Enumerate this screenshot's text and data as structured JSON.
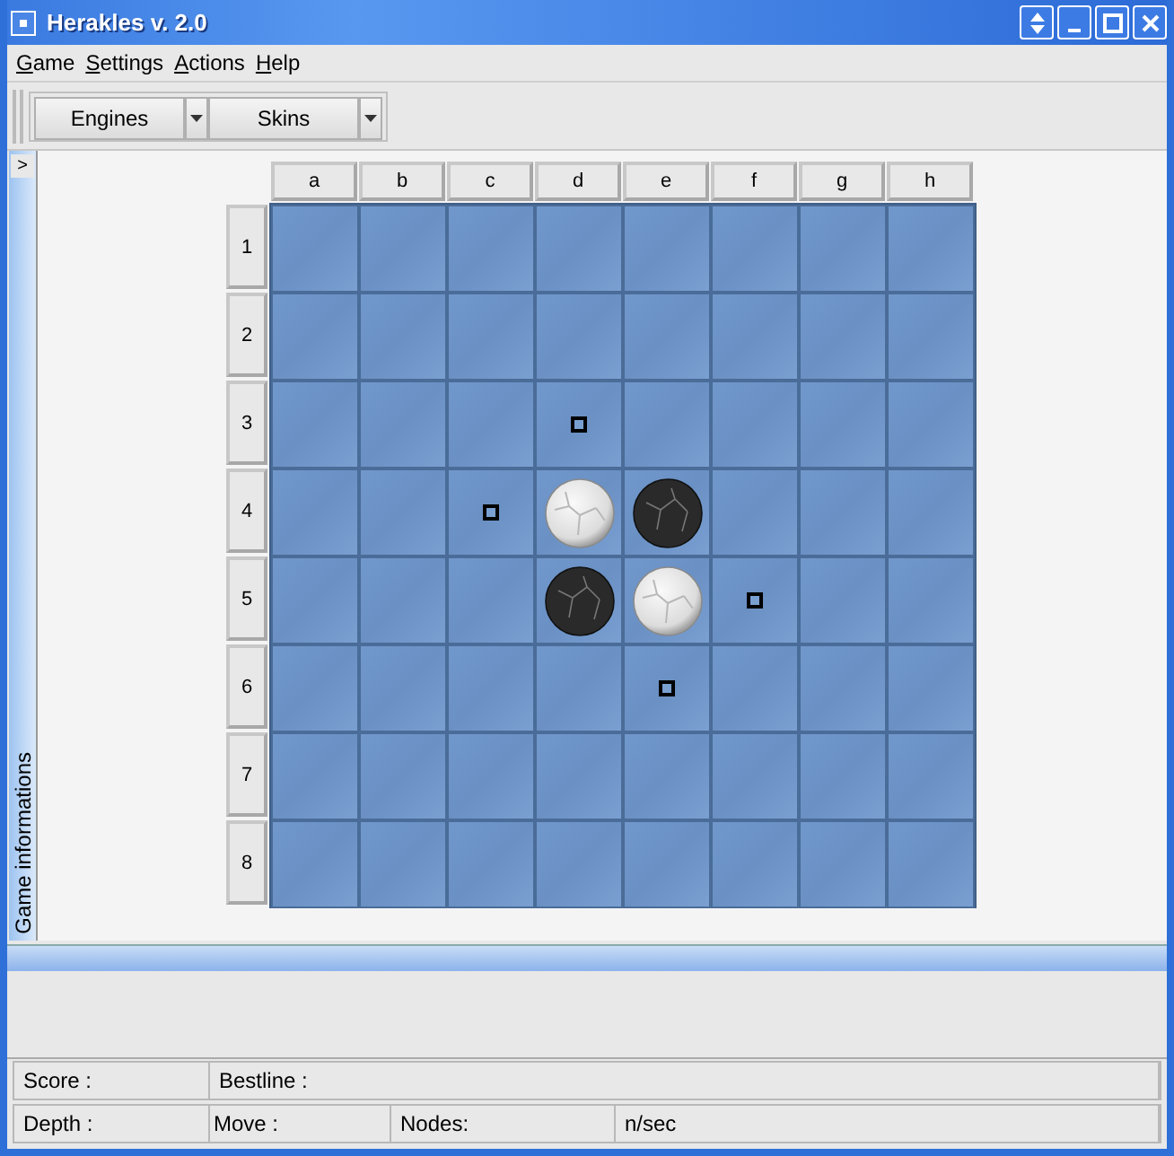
{
  "window": {
    "title": "Herakles v. 2.0"
  },
  "menu": [
    {
      "label": "Game"
    },
    {
      "label": "Settings"
    },
    {
      "label": "Actions"
    },
    {
      "label": "Help"
    }
  ],
  "toolbar": [
    {
      "label": "Engines"
    },
    {
      "label": "Skins"
    }
  ],
  "side_panel": {
    "toggle": ">",
    "title": "Game informations"
  },
  "board": {
    "columns": [
      "a",
      "b",
      "c",
      "d",
      "e",
      "f",
      "g",
      "h"
    ],
    "rows": [
      {
        "label": "1",
        "cells": [
          {
            "kind": "empty"
          },
          {
            "kind": "empty"
          },
          {
            "kind": "empty"
          },
          {
            "kind": "empty"
          },
          {
            "kind": "empty"
          },
          {
            "kind": "empty"
          },
          {
            "kind": "empty"
          },
          {
            "kind": "empty"
          }
        ]
      },
      {
        "label": "2",
        "cells": [
          {
            "kind": "empty"
          },
          {
            "kind": "empty"
          },
          {
            "kind": "empty"
          },
          {
            "kind": "empty"
          },
          {
            "kind": "empty"
          },
          {
            "kind": "empty"
          },
          {
            "kind": "empty"
          },
          {
            "kind": "empty"
          }
        ]
      },
      {
        "label": "3",
        "cells": [
          {
            "kind": "empty"
          },
          {
            "kind": "empty"
          },
          {
            "kind": "empty"
          },
          {
            "kind": "hint"
          },
          {
            "kind": "empty"
          },
          {
            "kind": "empty"
          },
          {
            "kind": "empty"
          },
          {
            "kind": "empty"
          }
        ]
      },
      {
        "label": "4",
        "cells": [
          {
            "kind": "empty"
          },
          {
            "kind": "empty"
          },
          {
            "kind": "hint"
          },
          {
            "kind": "white"
          },
          {
            "kind": "black"
          },
          {
            "kind": "empty"
          },
          {
            "kind": "empty"
          },
          {
            "kind": "empty"
          }
        ]
      },
      {
        "label": "5",
        "cells": [
          {
            "kind": "empty"
          },
          {
            "kind": "empty"
          },
          {
            "kind": "empty"
          },
          {
            "kind": "black"
          },
          {
            "kind": "white"
          },
          {
            "kind": "hint"
          },
          {
            "kind": "empty"
          },
          {
            "kind": "empty"
          }
        ]
      },
      {
        "label": "6",
        "cells": [
          {
            "kind": "empty"
          },
          {
            "kind": "empty"
          },
          {
            "kind": "empty"
          },
          {
            "kind": "empty"
          },
          {
            "kind": "hint"
          },
          {
            "kind": "empty"
          },
          {
            "kind": "empty"
          },
          {
            "kind": "empty"
          }
        ]
      },
      {
        "label": "7",
        "cells": [
          {
            "kind": "empty"
          },
          {
            "kind": "empty"
          },
          {
            "kind": "empty"
          },
          {
            "kind": "empty"
          },
          {
            "kind": "empty"
          },
          {
            "kind": "empty"
          },
          {
            "kind": "empty"
          },
          {
            "kind": "empty"
          }
        ]
      },
      {
        "label": "8",
        "cells": [
          {
            "kind": "empty"
          },
          {
            "kind": "empty"
          },
          {
            "kind": "empty"
          },
          {
            "kind": "empty"
          },
          {
            "kind": "empty"
          },
          {
            "kind": "empty"
          },
          {
            "kind": "empty"
          },
          {
            "kind": "empty"
          }
        ]
      }
    ]
  },
  "status_bar": {
    "row_1": [
      "Score :",
      "Bestline :"
    ],
    "row_2": [
      "Depth :",
      "Move :",
      "Nodes:",
      "n/sec"
    ]
  }
}
